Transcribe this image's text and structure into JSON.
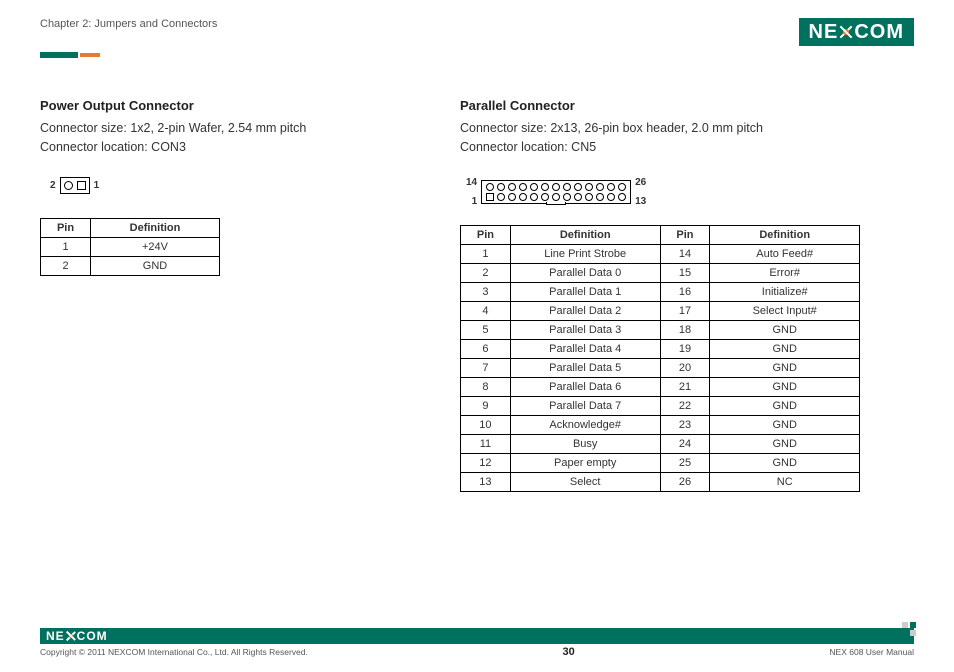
{
  "header": {
    "chapter": "Chapter 2: Jumpers and Connectors",
    "logo_left": "NE",
    "logo_right": "COM"
  },
  "left": {
    "title": "Power Output Connector",
    "desc_line1": "Connector size: 1x2, 2-pin Wafer, 2.54 mm pitch",
    "desc_line2": "Connector location: CON3",
    "diagram": {
      "left_label": "2",
      "right_label": "1"
    },
    "table": {
      "head_pin": "Pin",
      "head_def": "Definition",
      "rows": [
        {
          "pin": "1",
          "def": "+24V"
        },
        {
          "pin": "2",
          "def": "GND"
        }
      ]
    }
  },
  "right": {
    "title": "Parallel Connector",
    "desc_line1": "Connector size: 2x13, 26-pin box header, 2.0 mm pitch",
    "desc_line2": "Connector location: CN5",
    "diagram": {
      "tl": "14",
      "tr": "26",
      "bl": "1",
      "br": "13"
    },
    "table": {
      "head_pin": "Pin",
      "head_def": "Definition",
      "rows": [
        {
          "p1": "1",
          "d1": "Line Print Strobe",
          "p2": "14",
          "d2": "Auto Feed#"
        },
        {
          "p1": "2",
          "d1": "Parallel Data 0",
          "p2": "15",
          "d2": "Error#"
        },
        {
          "p1": "3",
          "d1": "Parallel Data 1",
          "p2": "16",
          "d2": "Initialize#"
        },
        {
          "p1": "4",
          "d1": "Parallel Data 2",
          "p2": "17",
          "d2": "Select Input#"
        },
        {
          "p1": "5",
          "d1": "Parallel Data 3",
          "p2": "18",
          "d2": "GND"
        },
        {
          "p1": "6",
          "d1": "Parallel Data 4",
          "p2": "19",
          "d2": "GND"
        },
        {
          "p1": "7",
          "d1": "Parallel Data 5",
          "p2": "20",
          "d2": "GND"
        },
        {
          "p1": "8",
          "d1": "Parallel Data 6",
          "p2": "21",
          "d2": "GND"
        },
        {
          "p1": "9",
          "d1": "Parallel Data 7",
          "p2": "22",
          "d2": "GND"
        },
        {
          "p1": "10",
          "d1": "Acknowledge#",
          "p2": "23",
          "d2": "GND"
        },
        {
          "p1": "11",
          "d1": "Busy",
          "p2": "24",
          "d2": "GND"
        },
        {
          "p1": "12",
          "d1": "Paper empty",
          "p2": "25",
          "d2": "GND"
        },
        {
          "p1": "13",
          "d1": "Select",
          "p2": "26",
          "d2": "NC"
        }
      ]
    }
  },
  "footer": {
    "logo_left": "NE",
    "logo_right": "COM",
    "copyright": "Copyright © 2011 NEXCOM International Co., Ltd. All Rights Reserved.",
    "page": "30",
    "manual": "NEX 608 User Manual"
  }
}
